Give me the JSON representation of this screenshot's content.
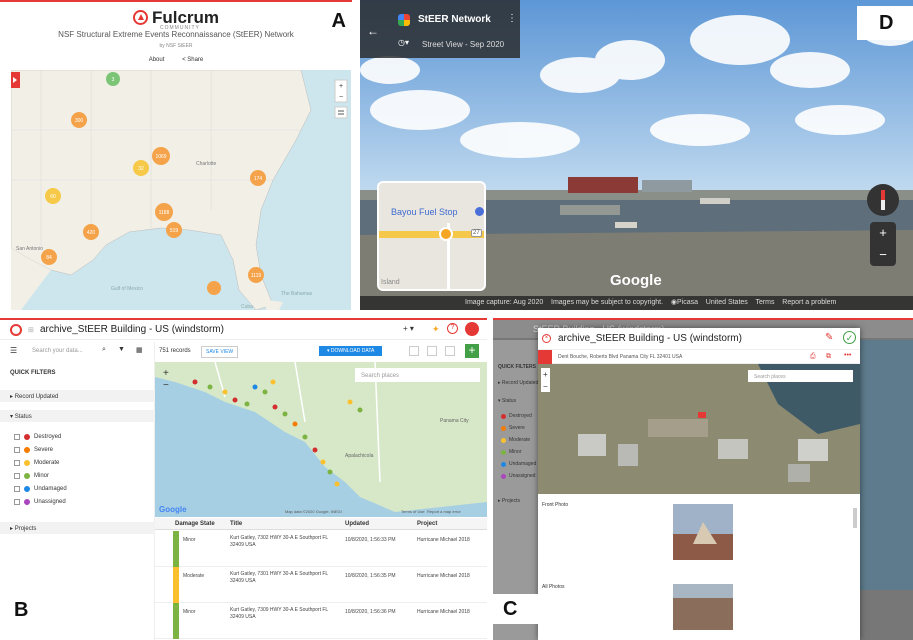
{
  "panelA": {
    "label": "A",
    "logo": "Fulcrum",
    "logo_sub": "COMMUNITY",
    "title": "NSF Structural Extreme Events Reconnaissance (StEER) Network",
    "byline": "by NSF StEER",
    "about_label": "About",
    "share_label": "< Share",
    "map_places": [
      "Charlotte",
      "San Antonio",
      "Gulf of Mexico",
      "The Bahamas",
      "Cuba"
    ],
    "clusters": [
      "3",
      "300",
      "1069",
      "32",
      "60",
      "1188",
      "420",
      "519",
      "84",
      "174",
      "1119"
    ]
  },
  "panelD": {
    "label": "D",
    "title": "StEER Network",
    "subtitle": "Street View - Sep 2020",
    "place_name": "Bayou Fuel Stop",
    "road_num": "27",
    "google": "Google",
    "bottom_items": [
      "Image capture: Aug 2020",
      "Images may be subject to copyright.",
      "Picasa",
      "United States",
      "Terms",
      "Report a problem"
    ],
    "mini_place": "Island"
  },
  "panelB": {
    "label": "B",
    "app_title": "archive_StEER Building - US (windstorm)",
    "search_placeholder": "Search your data...",
    "records": "751 records",
    "save_view": "SAVE VIEW",
    "download": "DOWNLOAD DATA",
    "search_places": "Search places",
    "quick_filters": "QUICK FILTERS",
    "record_updated": "Record Updated",
    "status": "Status",
    "statuses": [
      {
        "label": "Destroyed",
        "color": "#d32f2f"
      },
      {
        "label": "Severe",
        "color": "#f57c00"
      },
      {
        "label": "Moderate",
        "color": "#fbc02d"
      },
      {
        "label": "Minor",
        "color": "#7cb342"
      },
      {
        "label": "Undamaged",
        "color": "#1e88e5"
      },
      {
        "label": "Unassigned",
        "color": "#ab47bc"
      }
    ],
    "projects": "Projects",
    "table_headers": [
      "Damage State",
      "Title",
      "Updated",
      "Project"
    ],
    "rows": [
      {
        "state": "Minor",
        "color": "#7cb342",
        "title": "Kurt Gatley, 7302 HWY 30-A E Southport FL 32409 USA",
        "updated": "10/8/2020, 1:56:33 PM",
        "project": "Hurricane Michael 2018"
      },
      {
        "state": "Moderate",
        "color": "#fbc02d",
        "title": "Kurt Gatley, 7301 HWY 30-A E Southport FL 32409 USA",
        "updated": "10/8/2020, 1:56:35 PM",
        "project": "Hurricane Michael 2018"
      },
      {
        "state": "Minor",
        "color": "#7cb342",
        "title": "Kurt Gatley, 7309 HWY 30-A E Southport FL 32409 USA",
        "updated": "10/8/2020, 1:56:36 PM",
        "project": "Hurricane Michael 2018"
      }
    ],
    "map_credit": "Map data ©2020 Google, INEGI",
    "map_terms": "Terms of Use",
    "map_report": "Report a map error",
    "google": "Google",
    "panama_city": "Panama City",
    "apalachicola": "Apalachicola"
  },
  "panelC": {
    "label": "C",
    "bg_title": "StEER Building - US (windstorm)",
    "title": "archive_StEER Building - US (windstorm)",
    "address": "Dent Bouche, Roberts Blvd Panama City FL 32401 USA",
    "search_places": "Search places",
    "front_photo": "Front Photo",
    "all_photos": "All Photos",
    "quick_filters": "QUICK FILTERS",
    "record_updated": "Record Updated",
    "status": "Status",
    "projects": "Projects",
    "statuses": [
      "Destroyed",
      "Severe",
      "Moderate",
      "Minor",
      "Undamaged",
      "Unassigned"
    ]
  }
}
